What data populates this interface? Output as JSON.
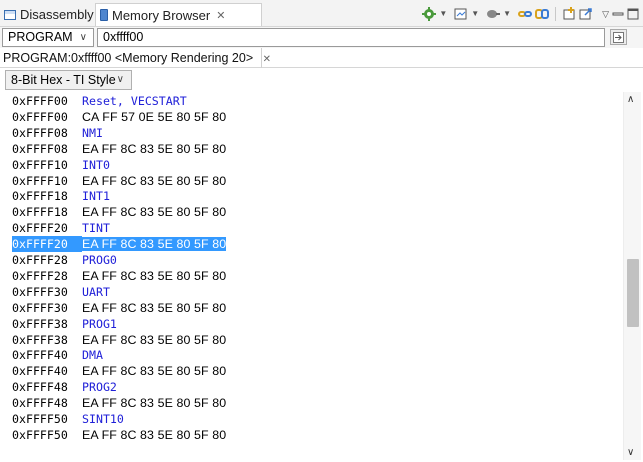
{
  "tabs": [
    {
      "label": "Disassembly",
      "icon": "disassembly-icon"
    },
    {
      "label": "Memory Browser",
      "icon": "memory-browser-icon",
      "close": "✕"
    }
  ],
  "toolbar_icons": [
    "refresh-settings-icon",
    "import-memory-icon",
    "connect-icon",
    "link-icon",
    "sync-icon",
    "new-rendering-icon",
    "export-icon",
    "view-menu-icon",
    "minimize-icon",
    "maximize-icon"
  ],
  "address_bar": {
    "space": "PROGRAM",
    "address": "0xffff00"
  },
  "rendering_tab": {
    "label": "PROGRAM:0xffff00 <Memory Rendering 20>",
    "close": "✕"
  },
  "format": "8-Bit Hex - TI Style",
  "memory_lines": [
    {
      "addr": "0xFFFF00",
      "symbol": "Reset, VECSTART"
    },
    {
      "addr": "0xFFFF00",
      "bytes": "CA FF 57 0E 5E 80 5F 80"
    },
    {
      "addr": "0xFFFF08",
      "symbol": "NMI"
    },
    {
      "addr": "0xFFFF08",
      "bytes": "EA FF 8C 83 5E 80 5F 80"
    },
    {
      "addr": "0xFFFF10",
      "symbol": "INT0"
    },
    {
      "addr": "0xFFFF10",
      "bytes": "EA FF 8C 83 5E 80 5F 80"
    },
    {
      "addr": "0xFFFF18",
      "symbol": "INT1"
    },
    {
      "addr": "0xFFFF18",
      "bytes": "EA FF 8C 83 5E 80 5F 80"
    },
    {
      "addr": "0xFFFF20",
      "symbol": "TINT"
    },
    {
      "addr": "0xFFFF20",
      "bytes": "EA FF 8C 83 5E 80 5F 80",
      "selected": true
    },
    {
      "addr": "0xFFFF28",
      "symbol": "PROG0"
    },
    {
      "addr": "0xFFFF28",
      "bytes": "EA FF 8C 83 5E 80 5F 80"
    },
    {
      "addr": "0xFFFF30",
      "symbol": "UART"
    },
    {
      "addr": "0xFFFF30",
      "bytes": "EA FF 8C 83 5E 80 5F 80"
    },
    {
      "addr": "0xFFFF38",
      "symbol": "PROG1"
    },
    {
      "addr": "0xFFFF38",
      "bytes": "EA FF 8C 83 5E 80 5F 80"
    },
    {
      "addr": "0xFFFF40",
      "symbol": "DMA"
    },
    {
      "addr": "0xFFFF40",
      "bytes": "EA FF 8C 83 5E 80 5F 80"
    },
    {
      "addr": "0xFFFF48",
      "symbol": "PROG2"
    },
    {
      "addr": "0xFFFF48",
      "bytes": "EA FF 8C 83 5E 80 5F 80"
    },
    {
      "addr": "0xFFFF50",
      "symbol": "SINT10"
    },
    {
      "addr": "0xFFFF50",
      "bytes": "EA FF 8C 83 5E 80 5F 80"
    }
  ],
  "colors": {
    "symbol": "#2020d8",
    "selection": "#3399ff"
  }
}
